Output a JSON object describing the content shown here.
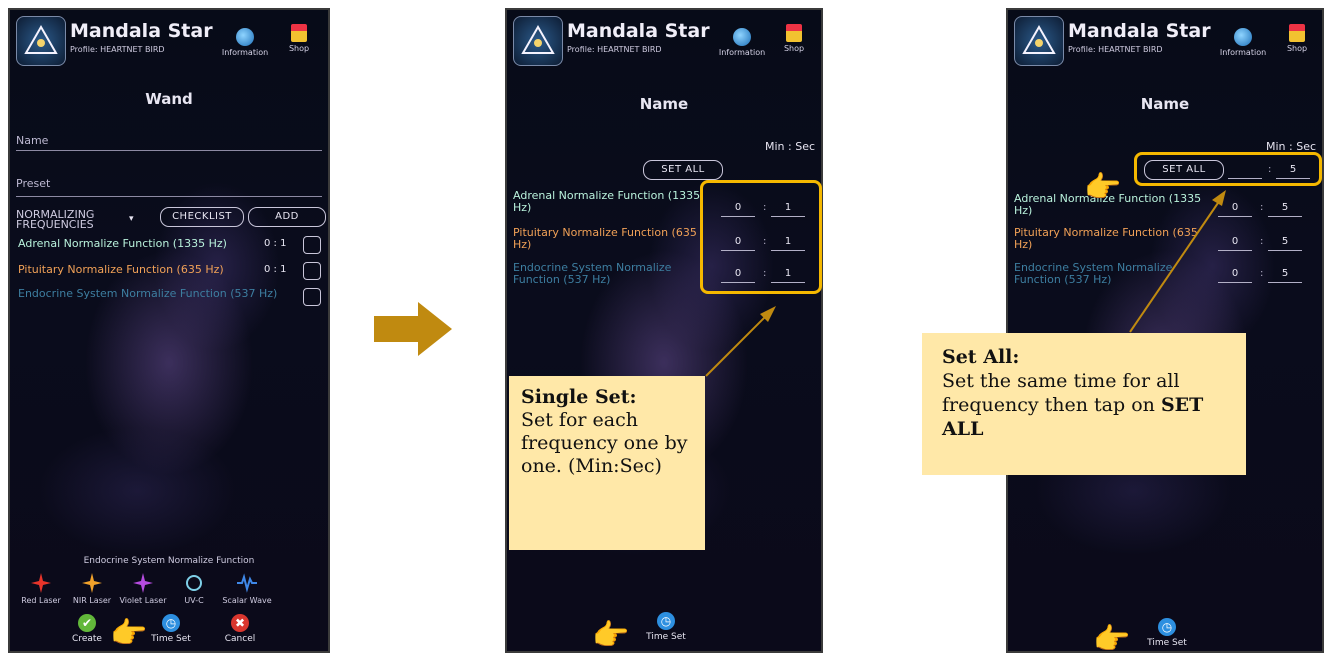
{
  "app": {
    "name": "Mandala Star",
    "profile": "Profile: HEARTNET BIRD",
    "info_label": "Information",
    "shop_label": "Shop"
  },
  "screen1": {
    "title": "Wand",
    "name_label": "Name",
    "preset_label": "Preset",
    "section_label": "NORMALIZING FREQUENCIES",
    "checklist_label": "CHECKLIST",
    "add_label": "ADD",
    "frequencies": [
      {
        "name": "Adrenal Normalize Function (1335 Hz)",
        "time": "0 : 1"
      },
      {
        "name": "Pituitary Normalize Function (635 Hz)",
        "time": "0 : 1"
      },
      {
        "name": "Endocrine System Normalize Function (537 Hz)",
        "time": "0 : 1"
      }
    ],
    "selected_function": "Endocrine System Normalize Function",
    "tools": [
      "Red Laser",
      "NIR Laser",
      "Violet Laser",
      "UV-C",
      "Scalar Wave"
    ],
    "create_label": "Create",
    "timeset_label": "Time Set",
    "cancel_label": "Cancel"
  },
  "screen2": {
    "title": "Name",
    "minsec_label": "Min : Sec",
    "setall_label": "SET ALL",
    "frequencies": [
      {
        "name": "Adrenal Normalize Function (1335 Hz)",
        "min": "0",
        "sec": "1"
      },
      {
        "name": "Pituitary Normalize Function (635 Hz)",
        "min": "0",
        "sec": "1"
      },
      {
        "name": "Endocrine System Normalize Function (537 Hz)",
        "min": "0",
        "sec": "1"
      }
    ],
    "timeset_label": "Time Set",
    "note_title": "Single Set:",
    "note_body": "Set for each frequency one by one. (Min:Sec)"
  },
  "screen3": {
    "title": "Name",
    "minsec_label": "Min : Sec",
    "setall_label": "SET ALL",
    "setall_sec": "5",
    "frequencies": [
      {
        "name": "Adrenal Normalize Function (1335 Hz)",
        "min": "0",
        "sec": "5"
      },
      {
        "name": "Pituitary Normalize Function (635 Hz)",
        "min": "0",
        "sec": "5"
      },
      {
        "name": "Endocrine System Normalize Function (537 Hz)",
        "min": "0",
        "sec": "5"
      }
    ],
    "timeset_label": "Time Set",
    "note_title": "Set All:",
    "note_body": "Set the same time for all frequency then tap on",
    "note_bold": "SET ALL"
  },
  "colors": {
    "accent": "#f5b800",
    "note_bg": "#ffe8a8",
    "arrow": "#c08a10",
    "green": "#b9f2dc",
    "orange": "#f1a157",
    "blue": "#3d7ea0"
  }
}
